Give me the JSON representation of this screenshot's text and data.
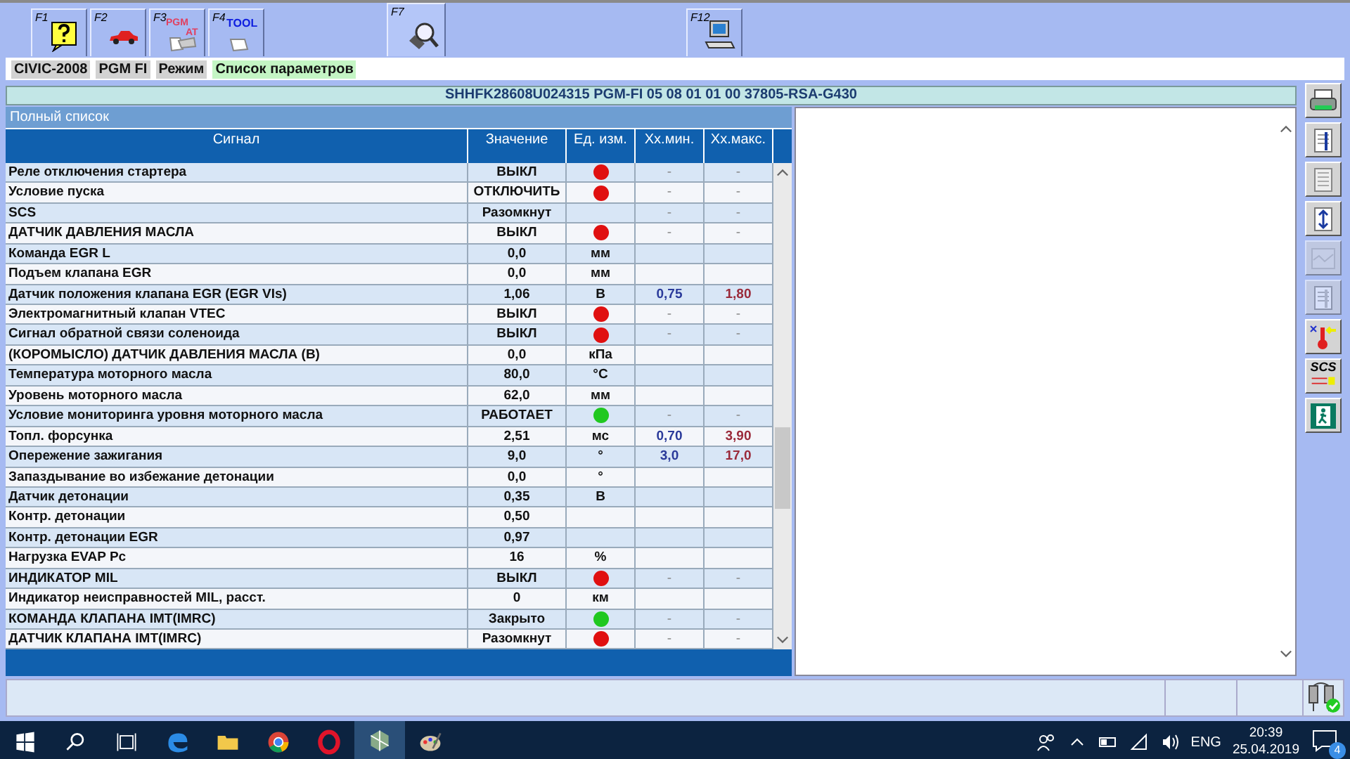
{
  "function_tabs": [
    {
      "key": "F1",
      "kind": "help",
      "selected": false
    },
    {
      "key": "F2",
      "kind": "car",
      "selected": false
    },
    {
      "key": "F3",
      "kind": "module",
      "icon_texts": [
        "PGM",
        "AT"
      ],
      "selected": false
    },
    {
      "key": "F4",
      "kind": "tool",
      "icon_texts": [
        "TOOL"
      ],
      "selected": false
    },
    {
      "key": "F7",
      "kind": "scan",
      "selected": true
    },
    {
      "key": "F12",
      "kind": "computer",
      "selected": false
    }
  ],
  "breadcrumb": [
    {
      "text": "CIVIC-2008",
      "kind": "plain"
    },
    {
      "text": "PGM FI",
      "kind": "plain"
    },
    {
      "text": "Режим",
      "kind": "plain"
    },
    {
      "text": "Список параметров",
      "kind": "current"
    }
  ],
  "vehicle_info": "SHHFK28608U024315  PGM-FI  05 08 01 01 00  37805-RSA-G430",
  "list_title": "Полный список",
  "table": {
    "columns": [
      "Сигнал",
      "Значение",
      "Ед. изм.",
      "Хх.мин.",
      "Хх.макс."
    ],
    "rows": [
      {
        "signal": "Реле отключения стартера",
        "value": "ВЫКЛ",
        "color": "#e01010",
        "min": "-",
        "max": "-"
      },
      {
        "signal": "Условие пуска",
        "value": "ОТКЛЮЧИТЬ",
        "color": "#e01010",
        "min": "-",
        "max": "-"
      },
      {
        "signal": "SCS",
        "value": "Разомкнут",
        "min": "-",
        "max": "-"
      },
      {
        "signal": "ДАТЧИК ДАВЛЕНИЯ МАСЛА",
        "value": "ВЫКЛ",
        "color": "#e01010",
        "min": "-",
        "max": "-"
      },
      {
        "signal": "Команда EGR L",
        "value": "0,0",
        "unit": "мм"
      },
      {
        "signal": "Подъем клапана EGR",
        "value": "0,0",
        "unit": "мм"
      },
      {
        "signal": "Датчик положения клапана EGR (EGR VIs)",
        "value": "1,06",
        "unit": "В",
        "min": "0,75",
        "max": "1,80"
      },
      {
        "signal": "Электромагнитный клапан VTEC",
        "value": "ВЫКЛ",
        "color": "#e01010",
        "min": "-",
        "max": "-"
      },
      {
        "signal": "Сигнал обратной связи соленоида",
        "value": "ВЫКЛ",
        "color": "#e01010",
        "min": "-",
        "max": "-"
      },
      {
        "signal": "(КОРОМЫСЛО) ДАТЧИК ДАВЛЕНИЯ МАСЛА (B)",
        "value": "0,0",
        "unit": "кПа"
      },
      {
        "signal": "Температура моторного масла",
        "value": "80,0",
        "unit": "°C"
      },
      {
        "signal": "Уровень моторного масла",
        "value": "62,0",
        "unit": "мм"
      },
      {
        "signal": "Условие мониторинга уровня моторного масла",
        "value": "РАБОТАЕТ",
        "color": "#20c820",
        "min": "-",
        "max": "-"
      },
      {
        "signal": "Топл. форсунка",
        "value": "2,51",
        "unit": "мс",
        "min": "0,70",
        "max": "3,90"
      },
      {
        "signal": "Опережение зажигания",
        "value": "9,0",
        "unit": "°",
        "min": "3,0",
        "max": "17,0"
      },
      {
        "signal": "Запаздывание во избежание детонации",
        "value": "0,0",
        "unit": "°"
      },
      {
        "signal": "Датчик детонации",
        "value": "0,35",
        "unit": "В"
      },
      {
        "signal": "Контр. детонации",
        "value": "0,50"
      },
      {
        "signal": "Контр. детонации EGR",
        "value": "0,97"
      },
      {
        "signal": "Нагрузка EVAP Pc",
        "value": "16",
        "unit": "%"
      },
      {
        "signal": "ИНДИКАТОР MIL",
        "value": "ВЫКЛ",
        "color": "#e01010",
        "min": "-",
        "max": "-"
      },
      {
        "signal": "Индикатор неисправностей MIL, расст.",
        "value": "0",
        "unit": "км"
      },
      {
        "signal": "КОМАНДА КЛАПАНА IMT(IMRC)",
        "value": "Закрыто",
        "color": "#20c820",
        "min": "-",
        "max": "-"
      },
      {
        "signal": "ДАТЧИК КЛАПАНА IMT(IMRC)",
        "value": "Разомкнут",
        "color": "#e01010",
        "min": "-",
        "max": "-"
      }
    ]
  },
  "side_tools": [
    {
      "kind": "printer",
      "disabled": false
    },
    {
      "kind": "select",
      "disabled": false
    },
    {
      "kind": "list",
      "disabled": false
    },
    {
      "kind": "updown",
      "disabled": false
    },
    {
      "kind": "graph",
      "disabled": true
    },
    {
      "kind": "select",
      "disabled": true
    },
    {
      "kind": "thermo",
      "disabled": false
    },
    {
      "kind": "scs",
      "text": "SCS",
      "disabled": false
    },
    {
      "kind": "exit",
      "disabled": false
    }
  ],
  "taskbar": {
    "apps": [
      {
        "kind": "edge",
        "selected": false
      },
      {
        "kind": "folder",
        "selected": false
      },
      {
        "kind": "chrome",
        "selected": false
      },
      {
        "kind": "opera",
        "selected": false
      },
      {
        "kind": "diag",
        "selected": true
      },
      {
        "kind": "paint",
        "selected": false
      }
    ],
    "language": "ENG",
    "time": "20:39",
    "date": "25.04.2019",
    "notifications": "4"
  }
}
